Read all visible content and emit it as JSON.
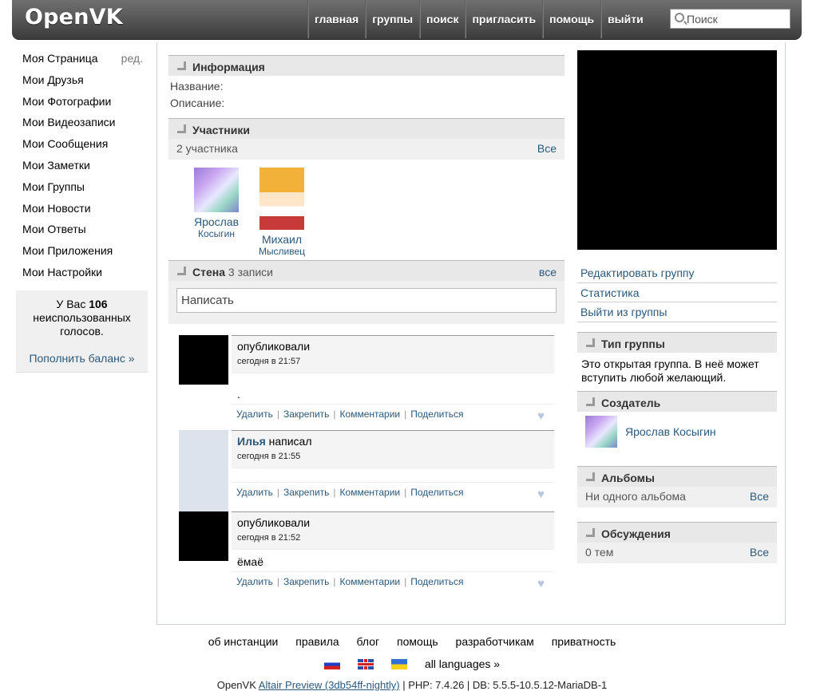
{
  "header": {
    "logo": "OpenVK",
    "nav": [
      "главная",
      "группы",
      "поиск",
      "пригласить",
      "помощь",
      "выйти"
    ],
    "search_placeholder": "Поиск"
  },
  "sidebar": {
    "items": [
      "Моя Страница",
      "Мои Друзья",
      "Мои Фотографии",
      "Мои Видеозаписи",
      "Мои Сообщения",
      "Мои Заметки",
      "Мои Группы",
      "Мои Новости",
      "Мои Ответы",
      "Мои Приложения",
      "Мои Настройки"
    ],
    "edit_label": "ред.",
    "votes_prefix": "У Вас",
    "votes_count": "106",
    "votes_suffix": "неиспользованных голосов.",
    "refill": "Пополнить баланс »"
  },
  "info": {
    "title": "Информация",
    "name_label": "Название:",
    "desc_label": "Описание:"
  },
  "members": {
    "title": "Участники",
    "count": "2 участника",
    "all": "Все",
    "list": [
      {
        "first": "Ярослав",
        "last": "Косыгин"
      },
      {
        "first": "Михаил",
        "last": "Мысливец"
      }
    ]
  },
  "wall": {
    "title": "Стена",
    "count": "3 записи",
    "all": "все",
    "placeholder": "Написать",
    "actions": [
      "Удалить",
      "Закрепить",
      "Комментарии",
      "Поделиться"
    ],
    "posts": [
      {
        "author_name": "",
        "author_action": "опубликовали",
        "date": "сегодня в 21:57",
        "text": "."
      },
      {
        "author_name": "Илья",
        "author_action": " написал",
        "date": "сегодня в 21:55",
        "text": ""
      },
      {
        "author_name": "",
        "author_action": "опубликовали",
        "date": "сегодня в 21:52",
        "text": "ёмаё"
      }
    ]
  },
  "right": {
    "links": [
      "Редактировать группу",
      "Статистика",
      "Выйти из группы"
    ],
    "type_title": "Тип группы",
    "type_text": "Это открытая группа. В неё может вступить любой желающий.",
    "creator_title": "Создатель",
    "creator_name": "Ярослав Косыгин",
    "albums_title": "Альбомы",
    "albums_count": "Ни одного альбома",
    "albums_all": "Все",
    "topics_title": "Обсуждения",
    "topics_count": "0 тем",
    "topics_all": "Все"
  },
  "footer": {
    "links": [
      "об инстанции",
      "правила",
      "блог",
      "помощь",
      "разработчикам",
      "приватность"
    ],
    "all_languages": "all languages »",
    "build_prefix": "OpenVK",
    "build_link": "Altair Preview (3db54ff-nightly)",
    "build_suffix": "| PHP: 7.4.26 | DB: 5.5.5-10.5.12-MariaDB-1"
  },
  "colors": {
    "link": "#2b587a",
    "header_dark": "#3b3b3b",
    "section_bg": "#e8e8e8"
  }
}
